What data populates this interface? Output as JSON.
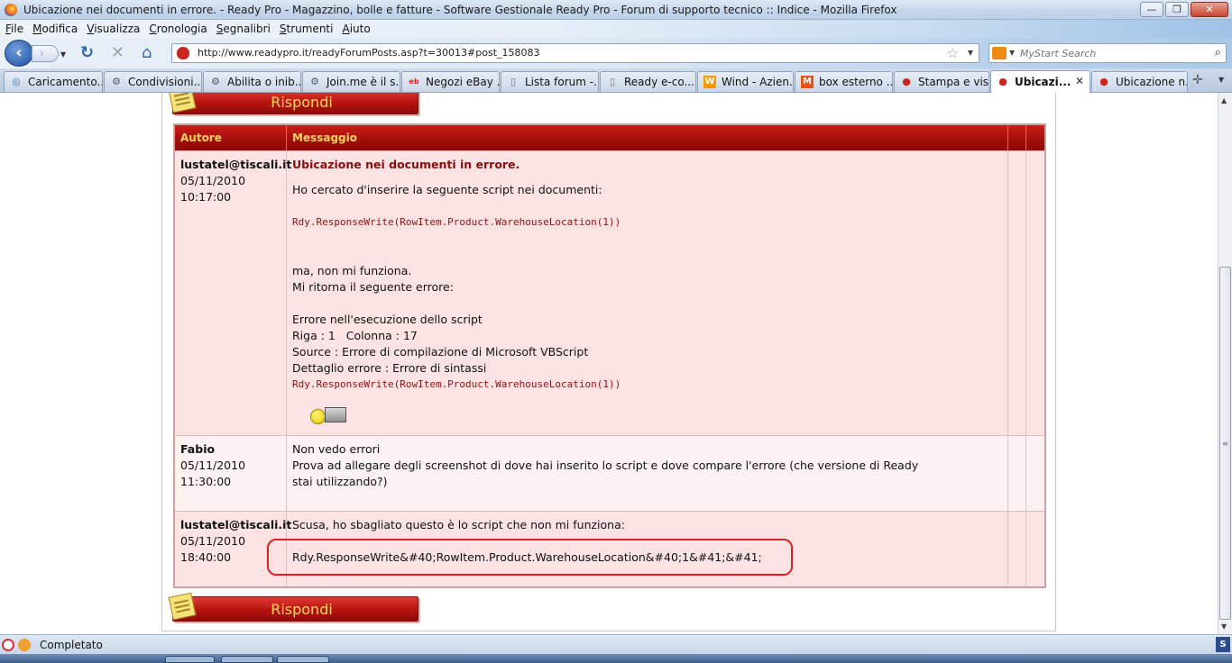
{
  "window": {
    "title": "Ubicazione nei documenti in errore. - Ready Pro - Magazzino, bolle e fatture - Software Gestionale Ready Pro - Forum di supporto tecnico :: Indice - Mozilla Firefox",
    "minimize": "—",
    "maximize": "❐",
    "close": "✕"
  },
  "menu": [
    "File",
    "Modifica",
    "Visualizza",
    "Cronologia",
    "Segnalibri",
    "Strumenti",
    "Aiuto"
  ],
  "nav": {
    "url": "http://www.readypro.it/readyForumPosts.asp?t=30013#post_158083",
    "search_placeholder": "MyStart Search"
  },
  "tabs": [
    {
      "label": "Caricamento...",
      "icon": "loading-icon"
    },
    {
      "label": "Condivisioni...",
      "icon": "network-icon"
    },
    {
      "label": "Abilita o inib...",
      "icon": "network-icon"
    },
    {
      "label": "Join.me è il s...",
      "icon": "network-icon"
    },
    {
      "label": "Negozi eBay ...",
      "icon": "ebay-icon"
    },
    {
      "label": "Lista forum -...",
      "icon": "page-icon"
    },
    {
      "label": "Ready e-co...",
      "icon": "page-icon"
    },
    {
      "label": "Wind - Azien...",
      "icon": "wind-icon"
    },
    {
      "label": "box esterno ...",
      "icon": "m-icon"
    },
    {
      "label": "Stampa e vis...",
      "icon": "strawberry-icon"
    },
    {
      "label": "Ubicazi...",
      "icon": "strawberry-icon",
      "active": true
    },
    {
      "label": "Ubicazione n...",
      "icon": "strawberry-icon"
    }
  ],
  "forum": {
    "reply_label": "Rispondi",
    "headers": {
      "author": "Autore",
      "message": "Messaggio"
    },
    "posts": [
      {
        "author": "lustatel@tiscali.it",
        "date": "05/11/2010",
        "time": "10:17:00",
        "subject": "Ubicazione nei documenti in errore.",
        "intro": "Ho cercato d'inserire la seguente script nei documenti:",
        "code1": "Rdy.ResponseWrite(RowItem.Product.WarehouseLocation(1))",
        "line_a": "ma, non mi funziona.",
        "line_b": "Mi ritorna il seguente errore:",
        "err1": "Errore nell'esecuzione dello script",
        "err2": "Riga : 1   Colonna : 17",
        "err3": "Source : Errore di compilazione di Microsoft VBScript",
        "err4": "Dettaglio errore : Errore di sintassi",
        "code2": "Rdy.ResponseWrite(RowItem.Product.WarehouseLocation(1))"
      },
      {
        "author": "Fabio",
        "date": "05/11/2010",
        "time": "11:30:00",
        "line1": "Non vedo errori",
        "line2": "Prova ad allegare degli screenshot di dove hai inserito lo script e dove compare l'errore (che versione di Ready",
        "line3": "stai utilizzando?)"
      },
      {
        "author": "lustatel@tiscali.it",
        "date": "05/11/2010",
        "time": "18:40:00",
        "line1": "Scusa, ho sbagliato questo è lo script che non mi funziona:",
        "line2": "Rdy.ResponseWrite&#40;RowItem.Product.WarehouseLocation&#40;1&#41;&#41;"
      }
    ]
  },
  "status": {
    "text": "Completato"
  },
  "colors": {
    "header_red": "#b6130f",
    "header_text": "#ffd45a",
    "row_pink": "#fbe3e3",
    "highlight": "#e02020"
  }
}
